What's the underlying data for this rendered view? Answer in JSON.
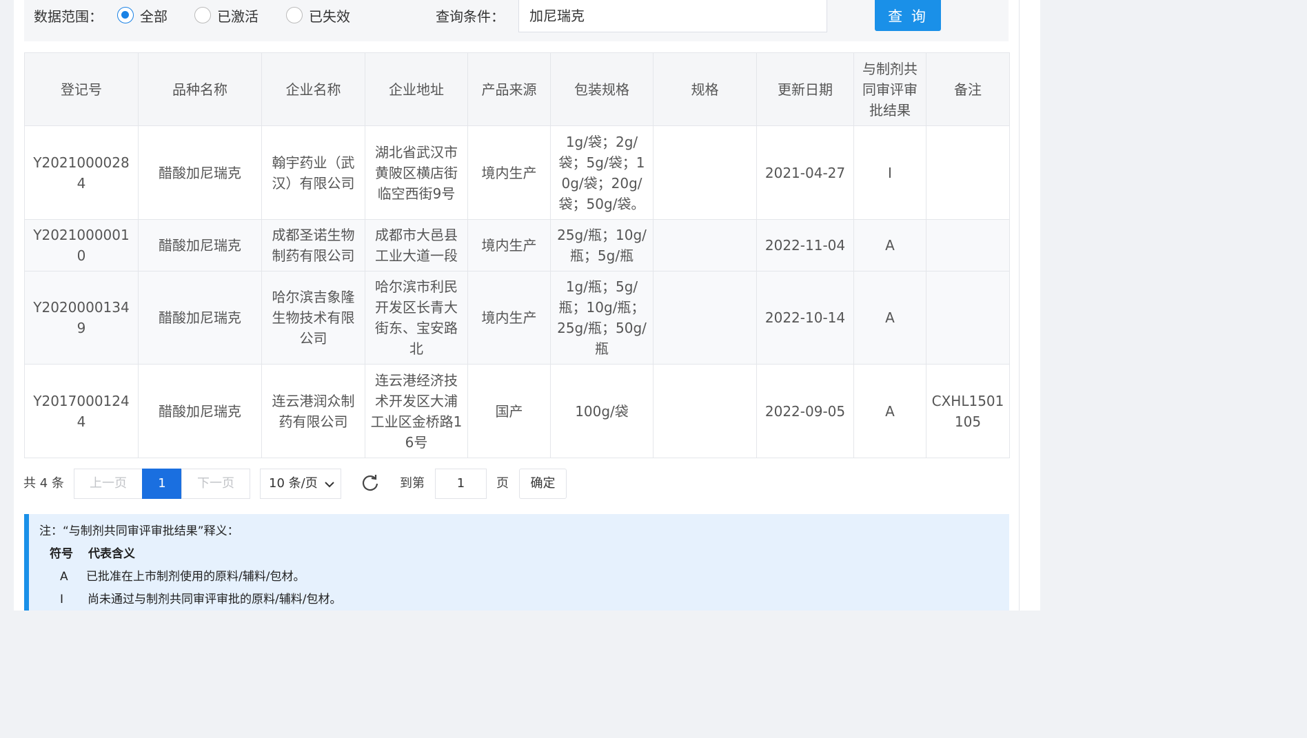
{
  "filter": {
    "scope_label": "数据范围：",
    "options": [
      "全部",
      "已激活",
      "已失效"
    ],
    "selected": "全部",
    "query_label": "查询条件：",
    "query_value": "加尼瑞克",
    "search_button": "查 询"
  },
  "table": {
    "headers": [
      "登记号",
      "品种名称",
      "企业名称",
      "企业地址",
      "产品来源",
      "包装规格",
      "规格",
      "更新日期",
      "与制剂共同审评审批结果",
      "备注"
    ],
    "rows": [
      [
        "Y20210000284",
        "醋酸加尼瑞克",
        "翰宇药业（武汉）有限公司",
        "湖北省武汉市黄陂区横店街临空西街9号",
        "境内生产",
        "1g/袋；2g/袋；5g/袋；10g/袋；20g/袋；50g/袋。",
        "",
        "2021-04-27",
        "I",
        ""
      ],
      [
        "Y20210000010",
        "醋酸加尼瑞克",
        "成都圣诺生物制药有限公司",
        "成都市大邑县工业大道一段",
        "境内生产",
        "25g/瓶；10g/瓶；5g/瓶",
        "",
        "2022-11-04",
        "A",
        ""
      ],
      [
        "Y20200001349",
        "醋酸加尼瑞克",
        "哈尔滨吉象隆生物技术有限公司",
        "哈尔滨市利民开发区长青大街东、宝安路北",
        "境内生产",
        "1g/瓶；5g/瓶；10g/瓶；25g/瓶；50g/瓶",
        "",
        "2022-10-14",
        "A",
        ""
      ],
      [
        "Y20170001244",
        "醋酸加尼瑞克",
        "连云港润众制药有限公司",
        "连云港经济技术开发区大浦工业区金桥路16号",
        "国产",
        "100g/袋",
        "",
        "2022-09-05",
        "A",
        "CXHL1501105"
      ]
    ]
  },
  "pagination": {
    "total": "共 4 条",
    "prev": "上一页",
    "current": "1",
    "next": "下一页",
    "page_size": "10 条/页",
    "goto_label": "到第",
    "goto_value": "1",
    "page_unit": "页",
    "confirm": "确定"
  },
  "note": {
    "title": "注：“与制剂共同审评审批结果”释义：",
    "col_symbol": "符号",
    "col_meaning": "代表含义",
    "items": [
      {
        "symbol": "A",
        "meaning": "已批准在上市制剂使用的原料/辅料/包材。"
      },
      {
        "symbol": "I",
        "meaning": "尚未通过与制剂共同审评审批的原料/辅料/包材。"
      }
    ]
  },
  "colors": {
    "accent": "#1a90e8",
    "active_page": "#1a6fe0",
    "note_bg": "#e6f1fd"
  }
}
